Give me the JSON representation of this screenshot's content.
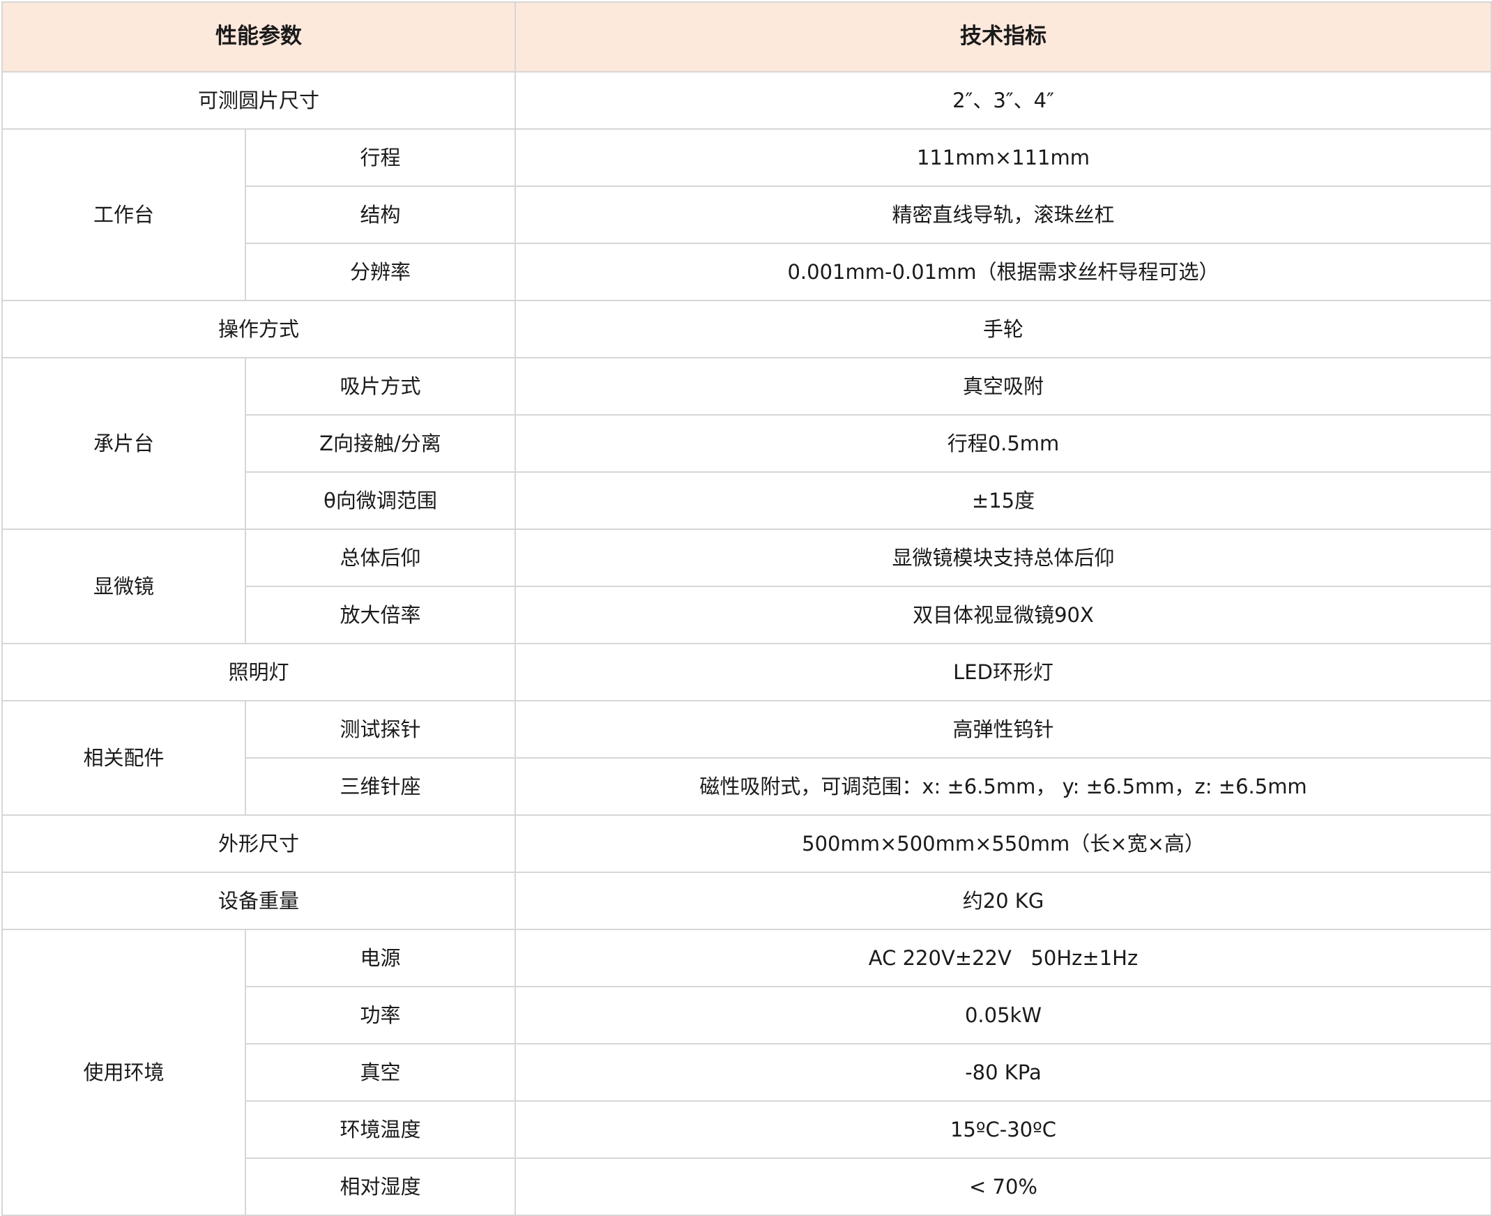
{
  "table": {
    "headers": [
      "性能参数",
      "技术指标"
    ],
    "rows": {
      "wafer_size": {
        "label": "可测圆片尺寸",
        "value": "2″、3″、4″"
      },
      "stage": {
        "label": "工作台",
        "items": [
          {
            "sub": "行程",
            "value": "111mm×111mm"
          },
          {
            "sub": "结构",
            "value": "精密直线导轨，滚珠丝杠"
          },
          {
            "sub": "分辨率",
            "value": "0.001mm-0.01mm（根据需求丝杆导程可选）"
          }
        ]
      },
      "operation": {
        "label": "操作方式",
        "value": "手轮"
      },
      "chuck": {
        "label": "承片台",
        "items": [
          {
            "sub": "吸片方式",
            "value": "真空吸附"
          },
          {
            "sub": "Z向接触/分离",
            "value": "行程0.5mm"
          },
          {
            "sub": "θ向微调范围",
            "value": "±15度"
          }
        ]
      },
      "microscope": {
        "label": "显微镜",
        "items": [
          {
            "sub": "总体后仰",
            "value": "显微镜模块支持总体后仰"
          },
          {
            "sub": "放大倍率",
            "value": "双目体视显微镜90X"
          }
        ]
      },
      "lamp": {
        "label": "照明灯",
        "value": "LED环形灯"
      },
      "accessories": {
        "label": "相关配件",
        "items": [
          {
            "sub": "测试探针",
            "value": "高弹性钨针"
          },
          {
            "sub": "三维针座",
            "value": "磁性吸附式，可调范围：x: ±6.5mm， y: ±6.5mm，z: ±6.5mm"
          }
        ]
      },
      "dimensions": {
        "label": "外形尺寸",
        "value": "500mm×500mm×550mm（长×宽×高）"
      },
      "weight": {
        "label": "设备重量",
        "value": "约20 KG"
      },
      "environment": {
        "label": "使用环境",
        "items": [
          {
            "sub": "电源",
            "value": "AC 220V±22V   50Hz±1Hz"
          },
          {
            "sub": "功率",
            "value": "0.05kW"
          },
          {
            "sub": "真空",
            "value": "-80 KPa"
          },
          {
            "sub": "环境温度",
            "value": "15ºC-30ºC"
          },
          {
            "sub": "相对湿度",
            "value": "< 70%"
          }
        ]
      }
    }
  },
  "colors": {
    "header_bg": "#fde8dc",
    "border": "#d6d6d6"
  }
}
